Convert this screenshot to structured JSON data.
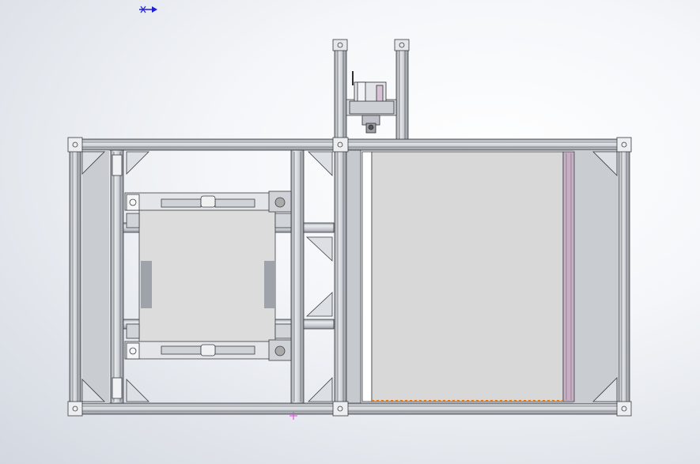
{
  "window": {
    "view": "front",
    "background_top": "#ffffff",
    "background_bottom": "#d3d8e0"
  },
  "colors": {
    "profile_fill": "#cfd3d8",
    "profile_line": "#3a3d42",
    "panel_fill": "#d8d8d8",
    "slot_white": "#ffffff",
    "accent_pink": "#c7b0c4",
    "origin_arrow": "#1f1fd6",
    "dotted_edge": "#e07818",
    "cursor_magenta": "#e040e0"
  },
  "icons": {
    "origin_indicator": "origin-triad-icon",
    "cursor": "cursor-crosshair-icon",
    "motor": "stepper-motor-icon"
  },
  "assembly": {
    "components": [
      "outer-frame",
      "motor-mount-tower",
      "stepper-motor",
      "left-bay-carriage",
      "right-bay-panel"
    ]
  }
}
